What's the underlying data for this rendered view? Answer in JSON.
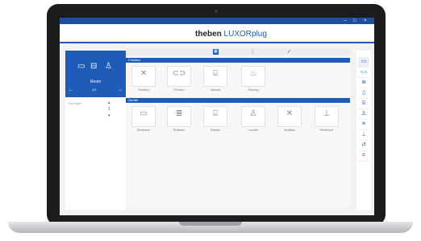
{
  "app": {
    "brand_first": "theben",
    "brand_second": " LUXORplug",
    "window_controls": [
      "–",
      "□",
      "×"
    ],
    "accent_color": "#1f5cb8"
  },
  "steps": [
    {
      "icon": "grid-icon",
      "glyph": "▦",
      "active": true
    },
    {
      "icon": "settings-sliders-icon",
      "glyph": "⋮",
      "active": false
    },
    {
      "icon": "check-icon",
      "glyph": "✓",
      "active": false
    }
  ],
  "left_panel": {
    "room_name": "Room",
    "prev_glyph": "←",
    "next_glyph": "→",
    "page_glyph": "1/1",
    "section_label": "Leitungen",
    "header_icons": [
      "socket-icon",
      "blind-icon",
      "person-icon"
    ],
    "header_glyphs": [
      "▭",
      "⊟",
      "♙"
    ],
    "stepper_up_glyph": "▴",
    "stepper_value": "1",
    "stepper_down_glyph": "▾"
  },
  "categories": [
    {
      "title": "Funktion",
      "items": [
        {
          "label": "Schalten",
          "icon": "switch-icon",
          "glyph": "✕"
        },
        {
          "label": "Dimmen",
          "icon": "dimmer-icon",
          "glyph": "⊂⊃"
        },
        {
          "label": "Jalousie",
          "icon": "blind-icon",
          "glyph": "⌸"
        },
        {
          "label": "Heizung",
          "icon": "heating-icon",
          "glyph": "♨"
        }
      ]
    },
    {
      "title": "Geräte",
      "items": [
        {
          "label": "Steckdose",
          "icon": "socket-icon",
          "glyph": "▭"
        },
        {
          "label": "Rollladen",
          "icon": "shutter-icon",
          "glyph": "≣"
        },
        {
          "label": "Markise",
          "icon": "awning-icon",
          "glyph": "⌸"
        },
        {
          "label": "Leuchte",
          "icon": "lamp-icon",
          "glyph": "♙"
        },
        {
          "label": "Ventilator",
          "icon": "fan-icon",
          "glyph": "✕"
        },
        {
          "label": "Heizkörper",
          "icon": "radiator-icon",
          "glyph": "⊥"
        }
      ]
    }
  ],
  "right_toolbar": [
    {
      "icon": "socket-icon",
      "glyph": "▭"
    },
    {
      "icon": "dimmer-icon",
      "glyph": "⊂⊃"
    },
    {
      "icon": "shutter-icon",
      "glyph": "≣"
    },
    {
      "icon": "awning-icon",
      "glyph": "▯"
    },
    {
      "icon": "blind-icon",
      "glyph": "⌸"
    },
    {
      "icon": "person-icon",
      "glyph": "♙"
    },
    {
      "icon": "switch-icon",
      "glyph": "✕"
    },
    {
      "icon": "heating-icon",
      "glyph": "⊥"
    },
    {
      "icon": "timer-icon",
      "glyph": "↺"
    },
    {
      "icon": "scene-icon",
      "glyph": "⌗"
    }
  ]
}
